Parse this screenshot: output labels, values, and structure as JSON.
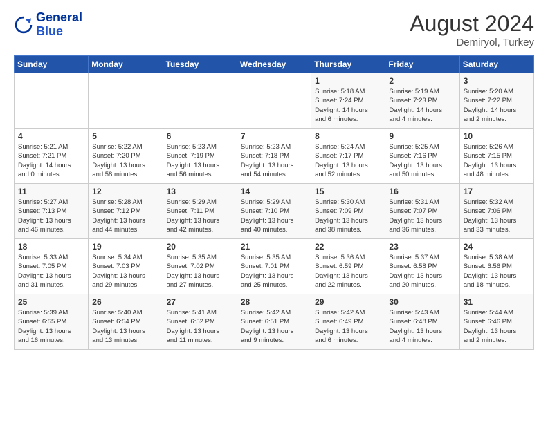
{
  "header": {
    "logo_line1": "General",
    "logo_line2": "Blue",
    "month_year": "August 2024",
    "location": "Demiryol, Turkey"
  },
  "days_of_week": [
    "Sunday",
    "Monday",
    "Tuesday",
    "Wednesday",
    "Thursday",
    "Friday",
    "Saturday"
  ],
  "weeks": [
    [
      {
        "day": "",
        "info": ""
      },
      {
        "day": "",
        "info": ""
      },
      {
        "day": "",
        "info": ""
      },
      {
        "day": "",
        "info": ""
      },
      {
        "day": "1",
        "info": "Sunrise: 5:18 AM\nSunset: 7:24 PM\nDaylight: 14 hours\nand 6 minutes."
      },
      {
        "day": "2",
        "info": "Sunrise: 5:19 AM\nSunset: 7:23 PM\nDaylight: 14 hours\nand 4 minutes."
      },
      {
        "day": "3",
        "info": "Sunrise: 5:20 AM\nSunset: 7:22 PM\nDaylight: 14 hours\nand 2 minutes."
      }
    ],
    [
      {
        "day": "4",
        "info": "Sunrise: 5:21 AM\nSunset: 7:21 PM\nDaylight: 14 hours\nand 0 minutes."
      },
      {
        "day": "5",
        "info": "Sunrise: 5:22 AM\nSunset: 7:20 PM\nDaylight: 13 hours\nand 58 minutes."
      },
      {
        "day": "6",
        "info": "Sunrise: 5:23 AM\nSunset: 7:19 PM\nDaylight: 13 hours\nand 56 minutes."
      },
      {
        "day": "7",
        "info": "Sunrise: 5:23 AM\nSunset: 7:18 PM\nDaylight: 13 hours\nand 54 minutes."
      },
      {
        "day": "8",
        "info": "Sunrise: 5:24 AM\nSunset: 7:17 PM\nDaylight: 13 hours\nand 52 minutes."
      },
      {
        "day": "9",
        "info": "Sunrise: 5:25 AM\nSunset: 7:16 PM\nDaylight: 13 hours\nand 50 minutes."
      },
      {
        "day": "10",
        "info": "Sunrise: 5:26 AM\nSunset: 7:15 PM\nDaylight: 13 hours\nand 48 minutes."
      }
    ],
    [
      {
        "day": "11",
        "info": "Sunrise: 5:27 AM\nSunset: 7:13 PM\nDaylight: 13 hours\nand 46 minutes."
      },
      {
        "day": "12",
        "info": "Sunrise: 5:28 AM\nSunset: 7:12 PM\nDaylight: 13 hours\nand 44 minutes."
      },
      {
        "day": "13",
        "info": "Sunrise: 5:29 AM\nSunset: 7:11 PM\nDaylight: 13 hours\nand 42 minutes."
      },
      {
        "day": "14",
        "info": "Sunrise: 5:29 AM\nSunset: 7:10 PM\nDaylight: 13 hours\nand 40 minutes."
      },
      {
        "day": "15",
        "info": "Sunrise: 5:30 AM\nSunset: 7:09 PM\nDaylight: 13 hours\nand 38 minutes."
      },
      {
        "day": "16",
        "info": "Sunrise: 5:31 AM\nSunset: 7:07 PM\nDaylight: 13 hours\nand 36 minutes."
      },
      {
        "day": "17",
        "info": "Sunrise: 5:32 AM\nSunset: 7:06 PM\nDaylight: 13 hours\nand 33 minutes."
      }
    ],
    [
      {
        "day": "18",
        "info": "Sunrise: 5:33 AM\nSunset: 7:05 PM\nDaylight: 13 hours\nand 31 minutes."
      },
      {
        "day": "19",
        "info": "Sunrise: 5:34 AM\nSunset: 7:03 PM\nDaylight: 13 hours\nand 29 minutes."
      },
      {
        "day": "20",
        "info": "Sunrise: 5:35 AM\nSunset: 7:02 PM\nDaylight: 13 hours\nand 27 minutes."
      },
      {
        "day": "21",
        "info": "Sunrise: 5:35 AM\nSunset: 7:01 PM\nDaylight: 13 hours\nand 25 minutes."
      },
      {
        "day": "22",
        "info": "Sunrise: 5:36 AM\nSunset: 6:59 PM\nDaylight: 13 hours\nand 22 minutes."
      },
      {
        "day": "23",
        "info": "Sunrise: 5:37 AM\nSunset: 6:58 PM\nDaylight: 13 hours\nand 20 minutes."
      },
      {
        "day": "24",
        "info": "Sunrise: 5:38 AM\nSunset: 6:56 PM\nDaylight: 13 hours\nand 18 minutes."
      }
    ],
    [
      {
        "day": "25",
        "info": "Sunrise: 5:39 AM\nSunset: 6:55 PM\nDaylight: 13 hours\nand 16 minutes."
      },
      {
        "day": "26",
        "info": "Sunrise: 5:40 AM\nSunset: 6:54 PM\nDaylight: 13 hours\nand 13 minutes."
      },
      {
        "day": "27",
        "info": "Sunrise: 5:41 AM\nSunset: 6:52 PM\nDaylight: 13 hours\nand 11 minutes."
      },
      {
        "day": "28",
        "info": "Sunrise: 5:42 AM\nSunset: 6:51 PM\nDaylight: 13 hours\nand 9 minutes."
      },
      {
        "day": "29",
        "info": "Sunrise: 5:42 AM\nSunset: 6:49 PM\nDaylight: 13 hours\nand 6 minutes."
      },
      {
        "day": "30",
        "info": "Sunrise: 5:43 AM\nSunset: 6:48 PM\nDaylight: 13 hours\nand 4 minutes."
      },
      {
        "day": "31",
        "info": "Sunrise: 5:44 AM\nSunset: 6:46 PM\nDaylight: 13 hours\nand 2 minutes."
      }
    ]
  ]
}
